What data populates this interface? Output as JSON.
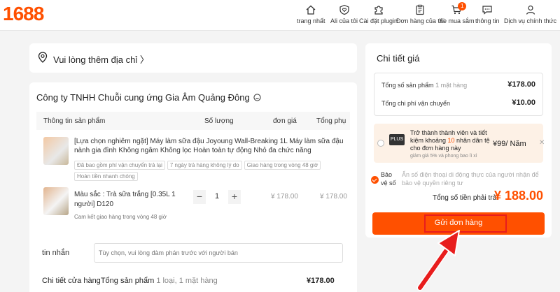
{
  "header": {
    "logo": "1688",
    "nav": [
      {
        "label": "trang nhất",
        "icon": "home-icon"
      },
      {
        "label": "Ali của tôi",
        "icon": "shield-heart-icon"
      },
      {
        "label": "Cài đặt plugin",
        "icon": "puzzle-icon"
      },
      {
        "label": "Đơn hàng của tôi",
        "icon": "clipboard-icon"
      },
      {
        "label": "Xe mua sắm",
        "icon": "cart-icon",
        "badge": "1"
      },
      {
        "label": "thông tin",
        "icon": "chat-icon"
      },
      {
        "label": "Dịch vụ chính thức",
        "icon": "user-icon"
      }
    ]
  },
  "address": {
    "label": "Vui lòng thêm địa chỉ"
  },
  "order": {
    "company": "Công ty TNHH Chuỗi cung ứng Gia Âm Quảng Đông",
    "columns": [
      "Thông tin sản phẩm",
      "Số lượng",
      "đơn giá",
      "Tổng phụ"
    ],
    "product": {
      "title": "[Lựa chọn nghiêm ngặt] Máy làm sữa đậu Joyoung Wall-Breaking 1L Máy làm sữa đậu nành gia đình Không ngâm Không lọc Hoàn toàn tự động Nhỏ đa chức năng",
      "tags": [
        "Đã bao gồm phí vận chuyển trả lại",
        "7 ngày trả hàng không lý do",
        "Giao hàng trong vòng 48 giờ",
        "Hoàn tiền nhanh chóng"
      ],
      "variant": "Màu sắc : Trà sữa trắng [0.35L 1 người] D120",
      "delivery": "Cam kết giao hàng trong vòng 48 giờ",
      "minus": "−",
      "quantity": "1",
      "plus": "+",
      "unit_price": "¥ 178.00",
      "subtotal": "¥ 178.00"
    },
    "message_label": "tin nhắn",
    "message_placeholder": "Tùy chọn, vui lòng đàm phán trước với người bán",
    "store_summary_label": "Chi tiết cửa hàng",
    "store_summary_products": "Tổng sản phẩm",
    "store_summary_count": "1 loại, 1 mặt hàng",
    "store_total": "¥178.00"
  },
  "price": {
    "title": "Chi tiết giá",
    "total_products_label": "Tổng số sản phẩm",
    "total_products_count": "1 mặt hàng",
    "total_products_value": "¥178.00",
    "shipping_label": "Tổng chi phí vận chuyển",
    "shipping_value": "¥10.00",
    "promo": {
      "badge": "PLUS",
      "text_1": "Trở thành thành viên và tiết kiệm khoảng ",
      "highlight": "10",
      "text_2": " nhân dân tệ cho đơn hàng này",
      "sub": "giảm giá 5% và phong bao lì xì",
      "price": "¥99/ Năm",
      "close": "✕"
    },
    "protect_label": "Bảo vệ số",
    "protect_desc": "Ẩn số điện thoại di động thực của người nhận để bảo vệ quyền riêng tư",
    "total_label": "Tổng số tiền phải trả",
    "total_value": "¥ 188.00",
    "submit": "Gửi đơn hàng"
  },
  "colors": {
    "accent": "#ff5000",
    "highlight_box": "#e81d1d"
  }
}
